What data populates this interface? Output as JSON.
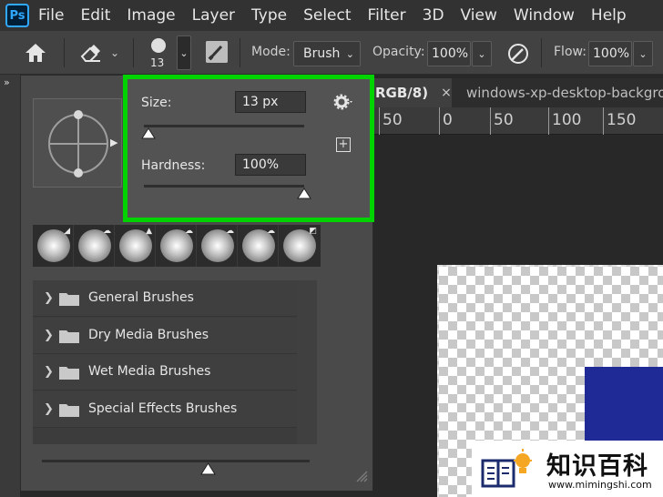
{
  "app": {
    "logo_text": "Ps"
  },
  "menu": [
    "File",
    "Edit",
    "Image",
    "Layer",
    "Type",
    "Select",
    "Filter",
    "3D",
    "View",
    "Window",
    "Help"
  ],
  "options_bar": {
    "brush_size_number": "13",
    "mode_label": "Mode:",
    "mode_value": "Brush",
    "opacity_label": "Opacity:",
    "opacity_value": "100%",
    "flow_label": "Flow:",
    "flow_value": "100%"
  },
  "tabs": [
    {
      "label": "RGB/8)",
      "close": "×",
      "active": true
    },
    {
      "label": "windows-xp-desktop-backgro",
      "active": false
    }
  ],
  "ruler": {
    "ticks": [
      "50",
      "0",
      "50",
      "100",
      "150"
    ]
  },
  "brush_panel": {
    "size_label": "Size:",
    "size_value": "13 px",
    "size_fraction": 0.03,
    "hardness_label": "Hardness:",
    "hardness_value": "100%",
    "hardness_fraction": 1.0,
    "folders": [
      "General Brushes",
      "Dry Media Brushes",
      "Wet Media Brushes",
      "Special Effects Brushes"
    ],
    "bottom_slider_fraction": 0.62
  },
  "watermark": {
    "title": "知识百科",
    "url": "www.mimingshi.com"
  },
  "colors": {
    "highlight": "#00d400",
    "canvas_blue": "#1f2a96",
    "ps_blue": "#31a8ff"
  }
}
